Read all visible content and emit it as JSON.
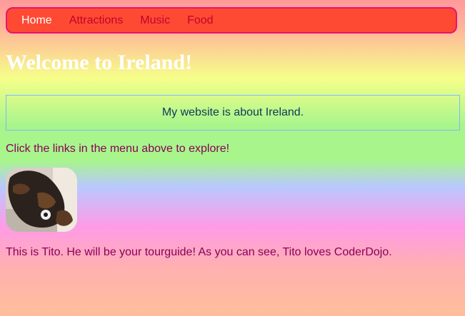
{
  "menu": {
    "items": [
      {
        "label": "Home"
      },
      {
        "label": "Attractions"
      },
      {
        "label": "Music"
      },
      {
        "label": "Food"
      }
    ]
  },
  "page": {
    "title": "Welcome to Ireland!",
    "intro": "My website is about Ireland.",
    "explore_text": "Click the links in the menu above to explore!",
    "photo_icon": "dog-photo",
    "caption": "This is Tito. He will be your tourguide! As you can see, Tito loves CoderDojo."
  },
  "colors": {
    "menu_background": "#ff4a33",
    "menu_border": "#e8146f",
    "menu_text": "#c4002d",
    "active_menu_text": "#ffffff",
    "body_text": "#8a0057",
    "intro_text": "#0c3a5a"
  }
}
